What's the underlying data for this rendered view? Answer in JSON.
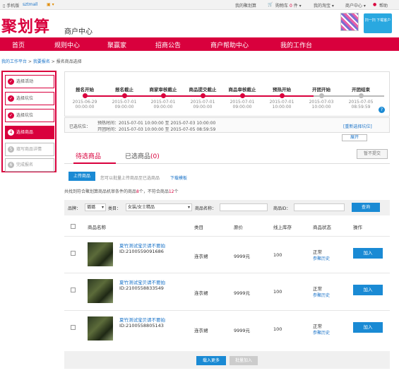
{
  "topbar": {
    "mobile": "手机版",
    "user": "sztmall",
    "cart": "购物车",
    "cart_count": "0",
    "cart_unit": "件",
    "my_juhuasuan": "我的聚划算",
    "my_taobao": "我的淘宝",
    "merchant_center": "商户中心",
    "help": "帮助"
  },
  "header": {
    "logo": "聚划算",
    "subtitle": "商户中心",
    "promo": "扫一扫 下载客户"
  },
  "nav": [
    "首页",
    "规则中心",
    "聚赢家",
    "招商公告",
    "商户帮助中心",
    "我的工作台"
  ],
  "breadcrumb": {
    "a": "我的工作平台",
    "sep": " > ",
    "b": "我要报名",
    "c": "报名商品选择"
  },
  "sidebar": [
    "选择活动",
    "选择坑位",
    "选择坑位",
    "选择商品",
    "填写商品详情",
    "完成报名"
  ],
  "sidebar_nums": [
    "",
    "",
    "",
    "4",
    "5",
    "6"
  ],
  "timeline": [
    {
      "title": "报名开始",
      "date": "2015-06-29",
      "time": "00:00:00"
    },
    {
      "title": "报名截止",
      "date": "2015-07-01",
      "time": "09:00:00"
    },
    {
      "title": "商家审核截止",
      "date": "2015-07-01",
      "time": "09:00:00"
    },
    {
      "title": "商品提交截止",
      "date": "2015-07-01",
      "time": "09:00:00"
    },
    {
      "title": "商品审核截止",
      "date": "2015-07-01",
      "time": "09:00:00"
    },
    {
      "title": "预热开始",
      "date": "2015-07-01",
      "time": "10:00:00"
    },
    {
      "title": "开团开始",
      "date": "2015-07-03",
      "time": "10:00:00"
    },
    {
      "title": "开团结束",
      "date": "2015-07-05",
      "time": "08:59:59"
    }
  ],
  "selected": {
    "label": "已选坑位：",
    "preheat": "预热时间：2015-07-01 10:00:00 至 2015-07-03 10:00:00",
    "open": "开团时间：2015-07-03 10:00:00 至 2015-07-05 08:59:59",
    "reselect": "[重新选择坑位]",
    "expand": "展开"
  },
  "tabs": {
    "pending": "待选商品",
    "selected": "已选商品",
    "selected_count": "(0)",
    "submit": "暂不提交"
  },
  "upload": {
    "button": "上传商品",
    "hint": "您可以批量上传商品至已选商品",
    "download": "下载模板"
  },
  "summary": {
    "pre": "共找到符合聚划算商品机审条件的商品",
    "n1": "8",
    "mid": "个，不符合商品",
    "n2": "12",
    "post": "个"
  },
  "search": {
    "brand_label": "品牌：",
    "brand_value": "璐璐",
    "cat_label": "类目：",
    "cat_value": "女装/女士精品",
    "name_label": "商品名称：",
    "id_label": "商品ID：",
    "query": "查询"
  },
  "table": {
    "headers": [
      "商品名称",
      "类目",
      "原价",
      "线上库存",
      "商品状态",
      "操作"
    ],
    "rows": [
      {
        "title": "夏竹测试宝贝请不要拍",
        "id": "ID:2100559091686",
        "cat": "连衣裙",
        "price": "9999元",
        "stock": "100",
        "status": "正常",
        "history": "参聚历史",
        "action": "加入"
      },
      {
        "title": "夏竹测试宝贝请不要拍",
        "id": "ID:2100558833549",
        "cat": "连衣裙",
        "price": "9999元",
        "stock": "100",
        "status": "正常",
        "history": "参聚历史",
        "action": "加入"
      },
      {
        "title": "夏竹测试宝贝请不要拍",
        "id": "ID:2100558805143",
        "cat": "连衣裙",
        "price": "9999元",
        "stock": "100",
        "status": "正常",
        "history": "参聚历史",
        "action": "加入"
      }
    ]
  },
  "footer": {
    "load_more": "载入更多",
    "batch_add": "批量加入"
  }
}
